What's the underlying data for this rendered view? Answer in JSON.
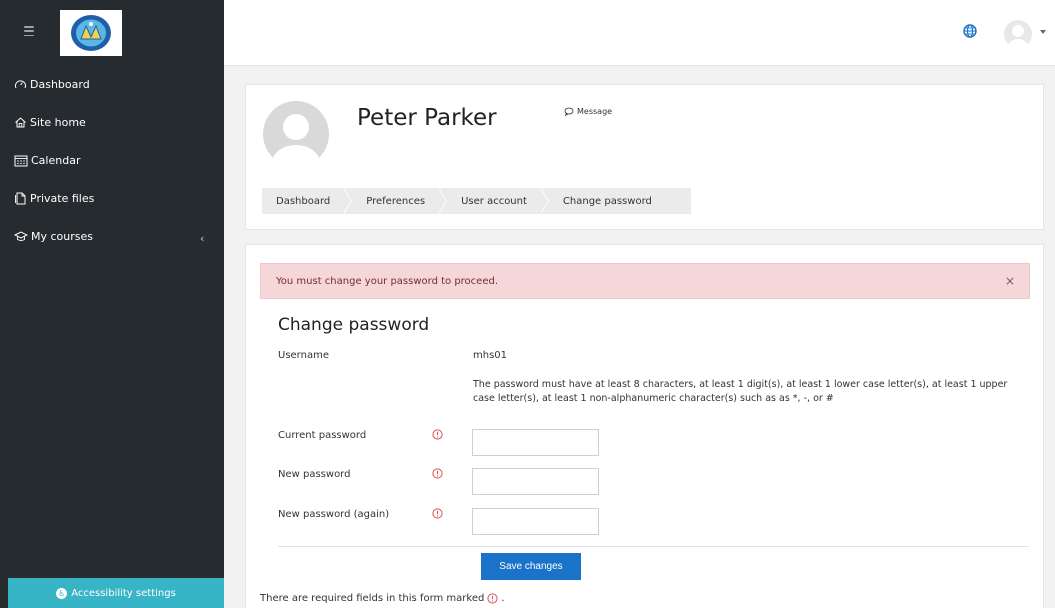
{
  "sidebar": {
    "items": [
      {
        "label": "Dashboard",
        "icon": "dashboard-icon"
      },
      {
        "label": "Site home",
        "icon": "home-icon"
      },
      {
        "label": "Calendar",
        "icon": "calendar-icon"
      },
      {
        "label": "Private files",
        "icon": "file-icon"
      },
      {
        "label": "My courses",
        "icon": "graduation-cap-icon"
      }
    ],
    "accessibility_label": "Accessibility settings"
  },
  "header": {
    "user_name": "Peter Parker",
    "message_label": "Message",
    "breadcrumb": [
      "Dashboard",
      "Preferences",
      "User account",
      "Change password"
    ]
  },
  "main": {
    "alert": "You must change your password to proceed.",
    "alert_close": "×",
    "form_title": "Change password",
    "username_label": "Username",
    "username_value": "mhs01",
    "password_help": "The password must have at least 8 characters, at least 1 digit(s), at least 1 lower case letter(s), at least 1 upper case letter(s), at least 1 non-alphanumeric character(s) such as as *, -, or #",
    "fields": [
      {
        "label": "Current password",
        "value": ""
      },
      {
        "label": "New password",
        "value": ""
      },
      {
        "label": "New password (again)",
        "value": ""
      }
    ],
    "save_label": "Save changes",
    "required_note_before": "There are required fields in this form marked",
    "required_note_after": "."
  },
  "colors": {
    "sidebar_bg": "#262b2f",
    "accent": "#1a73c9",
    "accessibility": "#38b4c7",
    "alert_bg": "#f5d6d9",
    "required": "#e05252"
  }
}
